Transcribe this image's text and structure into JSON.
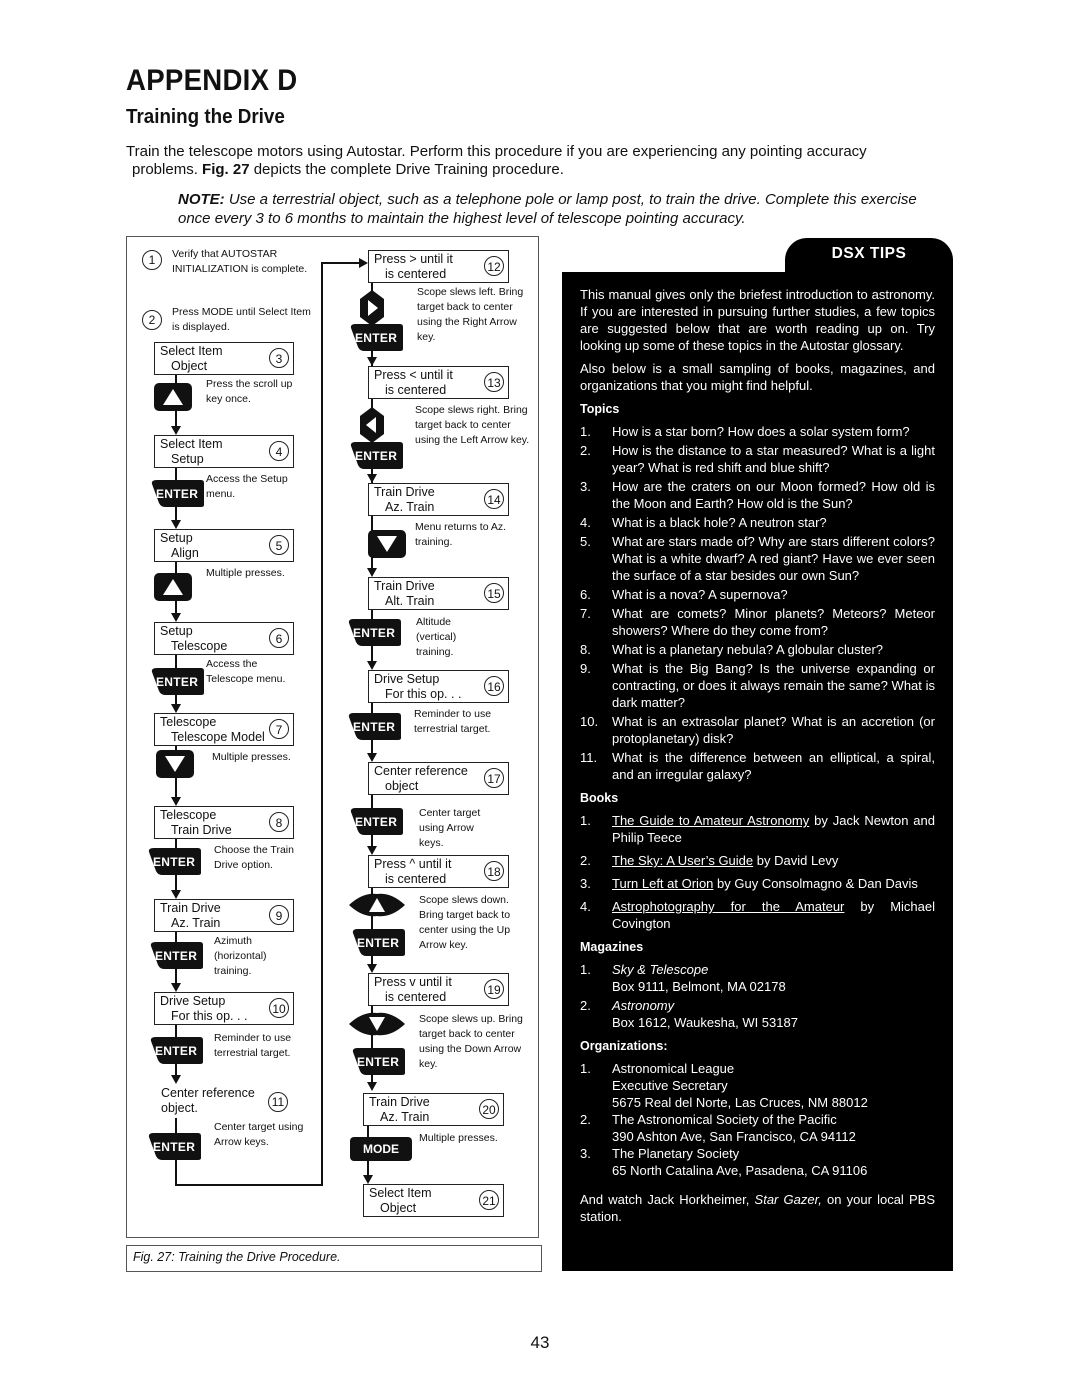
{
  "header": {
    "appendix": "APPENDIX D",
    "subtitle": "Training the Drive",
    "intro_line1": "Train the telescope motors using Autostar. Perform this procedure if you are experiencing any pointing accuracy",
    "intro_line2_pre": "problems.",
    "intro_line2_bold": "Fig. 27",
    "intro_line2_post": "depicts the complete Drive Training procedure.",
    "note_label": "NOTE:",
    "note_text": "Use a terrestrial object, such as a telephone pole or lamp post, to train the drive. Complete this exercise once every 3 to 6 months to maintain the highest level of telescope pointing accuracy."
  },
  "figure": {
    "caption": "Fig. 27: Training the Drive Procedure.",
    "keys": {
      "enter": "ENTER",
      "mode": "MODE"
    },
    "steps": [
      {
        "n": "1",
        "text": "Verify that AUTOSTAR INITIALIZATION is complete."
      },
      {
        "n": "2",
        "text": "Press MODE until Select Item is displayed."
      },
      {
        "n": "3",
        "line1": "Select Item",
        "line2": "Object",
        "note": "Press the scroll up key once.",
        "key": "up"
      },
      {
        "n": "4",
        "line1": "Select Item",
        "line2": "Setup",
        "note": "Access the Setup menu.",
        "key": "enter"
      },
      {
        "n": "5",
        "line1": "Setup",
        "line2": "Align",
        "note": "Multiple presses.",
        "key": "up"
      },
      {
        "n": "6",
        "line1": "Setup",
        "line2": "Telescope",
        "note": "Access the Telescope menu.",
        "key": "enter"
      },
      {
        "n": "7",
        "line1": "Telescope",
        "line2": "Telescope Model",
        "note": "Multiple presses.",
        "key": "down"
      },
      {
        "n": "8",
        "line1": "Telescope",
        "line2": "Train Drive",
        "note": "Choose the Train Drive option.",
        "key": "enter"
      },
      {
        "n": "9",
        "line1": "Train Drive",
        "line2": "Az. Train",
        "note": "Azimuth (horizontal) training.",
        "key": "enter"
      },
      {
        "n": "10",
        "line1": "Drive Setup",
        "line2": "For this op. . .",
        "note": "Reminder to use terrestrial target.",
        "key": "enter"
      },
      {
        "n": "11",
        "line1": "Center reference",
        "line2": "object.",
        "note": "Center target using Arrow keys.",
        "key": "enter"
      },
      {
        "n": "12",
        "line1": "Press  >  until it",
        "line2": "is centered",
        "note": "Scope slews left. Bring target back to center using the Right Arrow key.",
        "key": "right+enter"
      },
      {
        "n": "13",
        "line1": "Press  <  until it",
        "line2": "is centered",
        "note": "Scope slews right. Bring target back to center using the Left Arrow key.",
        "key": "left+enter"
      },
      {
        "n": "14",
        "line1": "Train Drive",
        "line2": "Az. Train",
        "note": "Menu returns to Az. training.",
        "key": "down"
      },
      {
        "n": "15",
        "line1": "Train Drive",
        "line2": "Alt. Train",
        "note": "Altitude (vertical) training.",
        "key": "enter"
      },
      {
        "n": "16",
        "line1": "Drive Setup",
        "line2": "For this op. . .",
        "note": "Reminder to use terrestrial target.",
        "key": "enter"
      },
      {
        "n": "17",
        "line1": "Center reference",
        "line2": "object",
        "note": "Center target using Arrow keys.",
        "key": "enter"
      },
      {
        "n": "18",
        "line1": "Press ^ until it",
        "line2": "is centered",
        "note": "Scope slews down. Bring target back to center using the Up Arrow key.",
        "key": "up+enter"
      },
      {
        "n": "19",
        "line1": "Press v until it",
        "line2": "is centered",
        "note": "Scope slews up. Bring target back to center using the Down Arrow key.",
        "key": "down+enter"
      },
      {
        "n": "20",
        "line1": "Train Drive",
        "line2": "Az. Train",
        "note": "Multiple presses.",
        "key": "mode"
      },
      {
        "n": "21",
        "line1": "Select Item",
        "line2": "Object"
      }
    ]
  },
  "tips": {
    "title": "DSX TIPS",
    "para1": "This manual gives only the briefest introduction to astronomy. If you are interested in pursuing further studies, a few topics are suggested below that are worth reading up on. Try looking up some of these topics in the Autostar glossary.",
    "para2": "Also below is a small sampling of books, magazines, and organizations that you might find helpful.",
    "topics_heading": "Topics",
    "topics": [
      "How is a star born? How does a solar system form?",
      "How is the distance to a star measured? What is a light year? What is red shift and blue shift?",
      "How are the craters on our Moon formed? How old is the Moon and Earth? How old is the Sun?",
      "What is a black hole? A neutron star?",
      "What are stars made of? Why are stars different colors? What is a white dwarf? A red giant? Have we ever seen the surface of a star besides our own Sun?",
      "What is a nova? A supernova?",
      "What are comets? Minor planets? Meteors? Meteor showers? Where do they come from?",
      "What is a planetary nebula? A globular cluster?",
      "What is the Big Bang? Is the universe expanding or contracting, or does it always remain the same? What is dark matter?",
      "What is an extrasolar planet? What is an accretion (or protoplanetary) disk?",
      "What is the difference between an elliptical, a spiral, and an irregular galaxy?"
    ],
    "books_heading": "Books",
    "books": [
      {
        "title": "The Guide to Amateur Astronomy",
        "by": "by Jack Newton and Philip Teece"
      },
      {
        "title": "The Sky: A User’s Guide",
        "by": "by David Levy"
      },
      {
        "title": "Turn Left at Orion",
        "by": "by Guy Consolmagno & Dan Davis"
      },
      {
        "title": "Astrophotography for the Amateur",
        "by": "by Michael Covington"
      }
    ],
    "magazines_heading": "Magazines",
    "magazines": [
      {
        "name": "Sky & Telescope",
        "address": "Box 9111, Belmont, MA 02178"
      },
      {
        "name": "Astronomy",
        "address": "Box 1612, Waukesha, WI 53187"
      }
    ],
    "orgs_heading": "Organizations:",
    "organizations": [
      {
        "lines": [
          "Astronomical League",
          "Executive Secretary",
          "5675 Real del Norte, Las Cruces, NM 88012"
        ]
      },
      {
        "lines": [
          "The Astronomical Society of the Pacific",
          "390 Ashton Ave, San Francisco, CA 94112"
        ]
      },
      {
        "lines": [
          "The Planetary Society",
          "65 North Catalina Ave, Pasadena, CA 91106"
        ]
      }
    ],
    "closing_pre": "And watch Jack Horkheimer,",
    "closing_italic": "Star Gazer,",
    "closing_post": "on your local PBS station."
  },
  "page_number": "43"
}
